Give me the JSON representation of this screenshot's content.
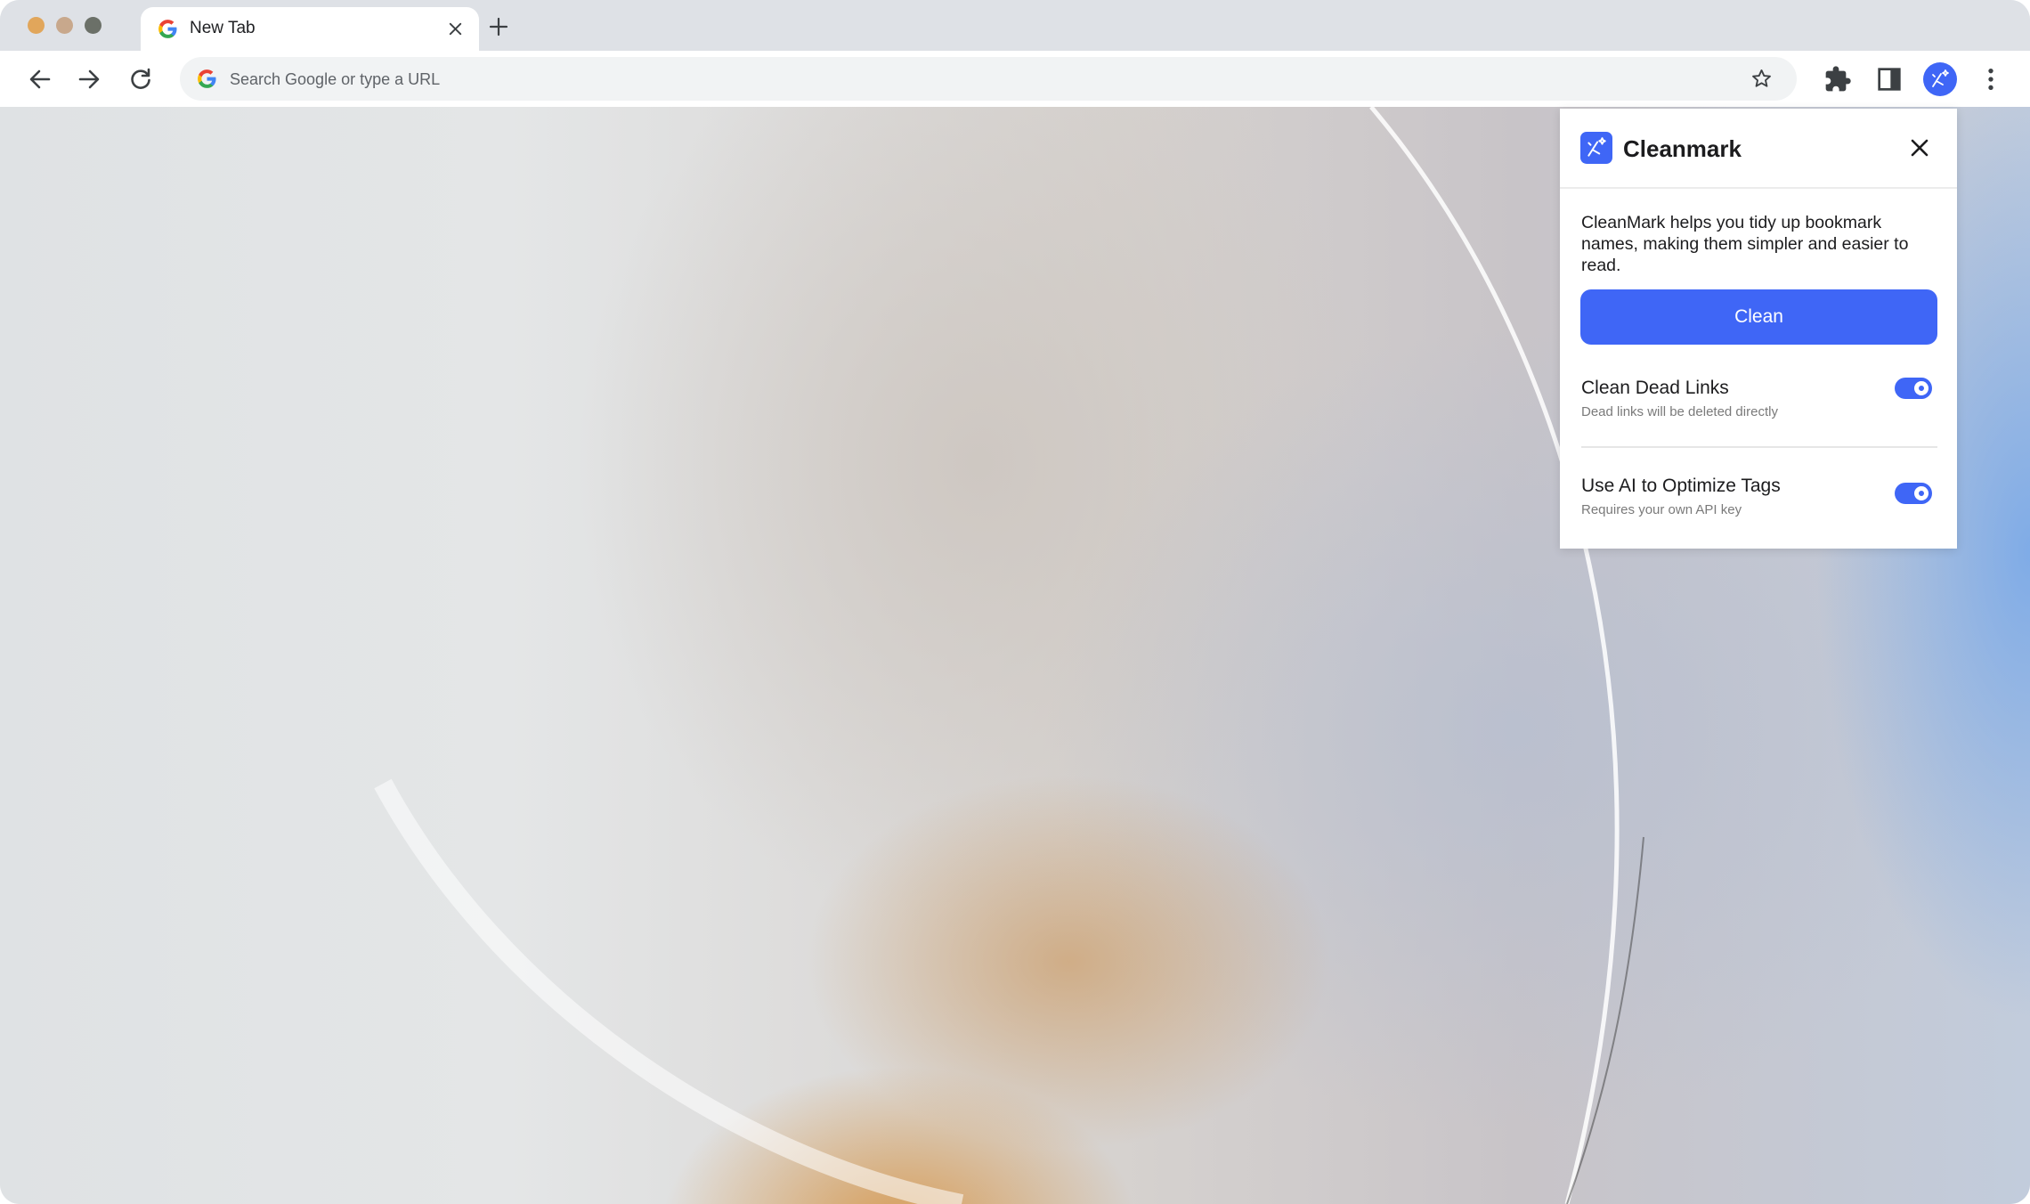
{
  "tabs": [
    {
      "title": "New Tab",
      "favicon": "google-g-icon"
    }
  ],
  "toolbar": {
    "search_placeholder": "Search Google or type a URL",
    "icons": [
      "back-icon",
      "forward-icon",
      "reload-icon",
      "bookmark-star-icon",
      "extensions-puzzle-icon",
      "side-panel-icon",
      "profile-avatar",
      "more-menu-icon"
    ]
  },
  "extension_popup": {
    "title": "Cleanmark",
    "description": "CleanMark helps you tidy up bookmark names, making them simpler and easier to read.",
    "clean_button_label": "Clean",
    "settings": [
      {
        "title": "Clean Dead Links",
        "subtitle": "Dead links will be deleted directly",
        "enabled": true
      },
      {
        "title": "Use AI to Optimize Tags",
        "subtitle": "Requires your own API key",
        "enabled": true
      }
    ]
  },
  "colors": {
    "accent": "#3f66f6",
    "tabstrip": "#dee1e6",
    "omnibox": "#f1f3f4",
    "traffic_close": "#e1a65b",
    "traffic_minimize": "#c8a88c",
    "traffic_zoom": "#6b7068"
  }
}
